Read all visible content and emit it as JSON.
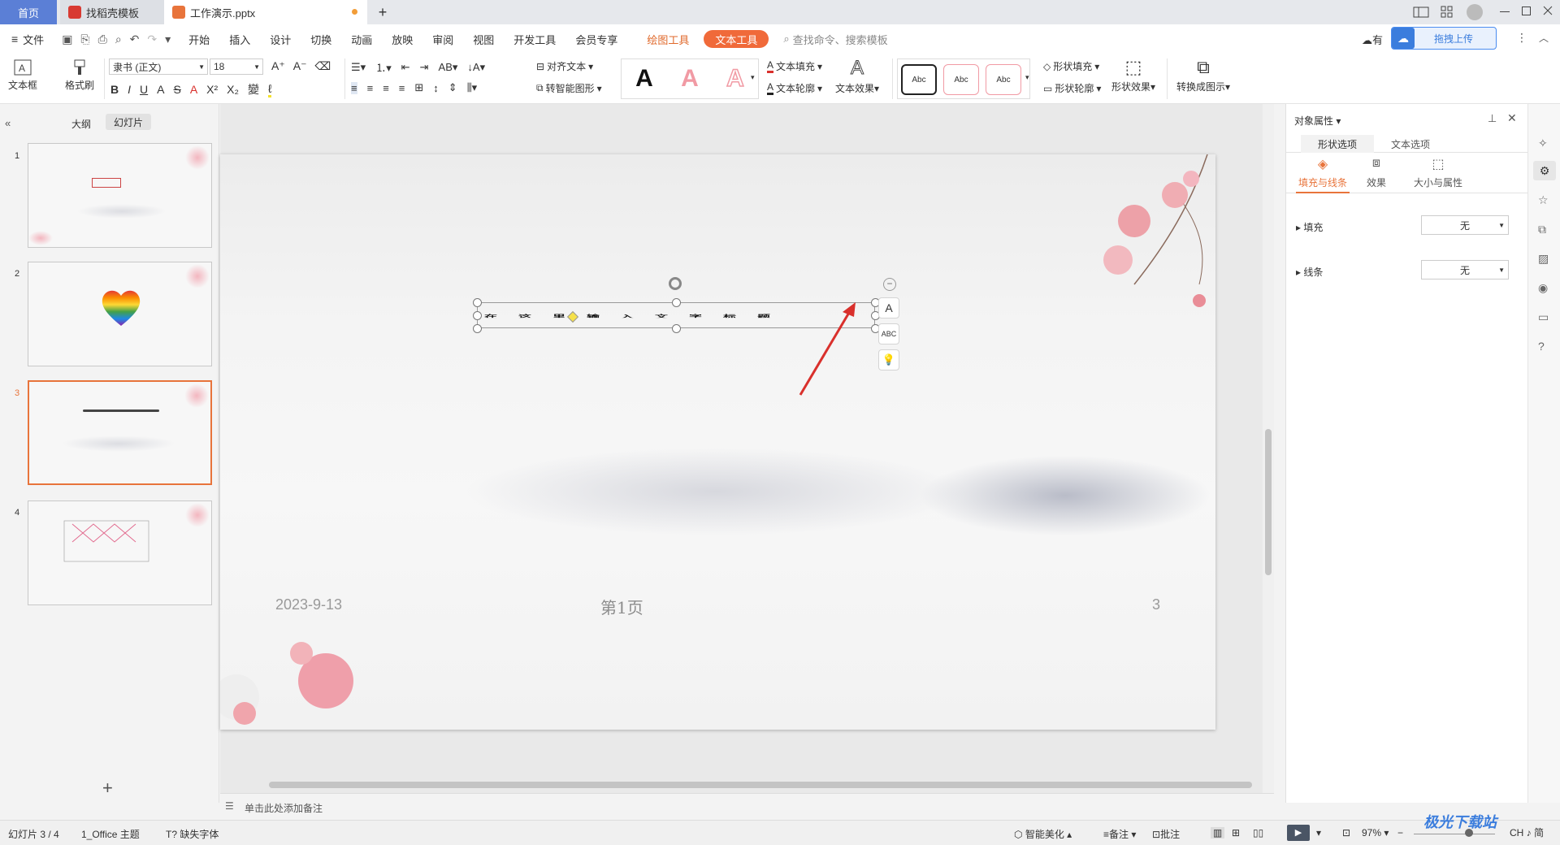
{
  "tabs": {
    "home": "首页",
    "template": "找稻壳模板",
    "file": "工作演示.pptx",
    "new_tab": "+"
  },
  "menu": {
    "file": "文件",
    "items": [
      "开始",
      "插入",
      "设计",
      "切换",
      "动画",
      "放映",
      "审阅",
      "视图",
      "开发工具",
      "会员专享"
    ],
    "draw_tool": "绘图工具",
    "text_tool": "文本工具",
    "search": "查找命令、搜索模板",
    "upload": "拖拽上传",
    "cloud": "有"
  },
  "ribbon": {
    "textbox": "文本框",
    "format_brush": "格式刷",
    "font": "隶书 (正文)",
    "size": "18",
    "align_text": "对齐文本",
    "smart_shape": "转智能图形",
    "text_fill": "文本填充",
    "text_outline": "文本轮廓",
    "text_effect": "文本效果",
    "style_sample": "Abc",
    "shape_fill": "形状填充",
    "shape_outline": "形状轮廓",
    "shape_effect": "形状效果",
    "convert": "转换成图示",
    "big_a": "A"
  },
  "left": {
    "outline": "大纲",
    "slides": "幻灯片",
    "numbers": [
      "1",
      "2",
      "3",
      "4"
    ],
    "add": "+"
  },
  "slide": {
    "date": "2023-9-13",
    "page": "第1页",
    "number": "3",
    "warped_text": "在这里输入文字标题"
  },
  "notes": {
    "placeholder": "单击此处添加备注"
  },
  "right": {
    "title": "对象属性",
    "tab_shape": "形状选项",
    "tab_text": "文本选项",
    "sub_fill": "填充与线条",
    "sub_effect": "效果",
    "sub_size": "大小与属性",
    "fill_label": "填充",
    "fill_value": "无",
    "line_label": "线条",
    "line_value": "无"
  },
  "status": {
    "slide_count": "幻灯片 3 / 4",
    "theme": "1_Office 主题",
    "missing_font": "缺失字体",
    "beautify": "智能美化",
    "notes": "备注",
    "comment": "批注",
    "zoom": "97%",
    "watermark": "极光下载站",
    "ime": "CH ♪ 简"
  },
  "colors": {
    "accent": "#e8743b",
    "brand_blue": "#3b7ddd",
    "selected_border": "#e8743b",
    "arrow": "#d9302c"
  }
}
